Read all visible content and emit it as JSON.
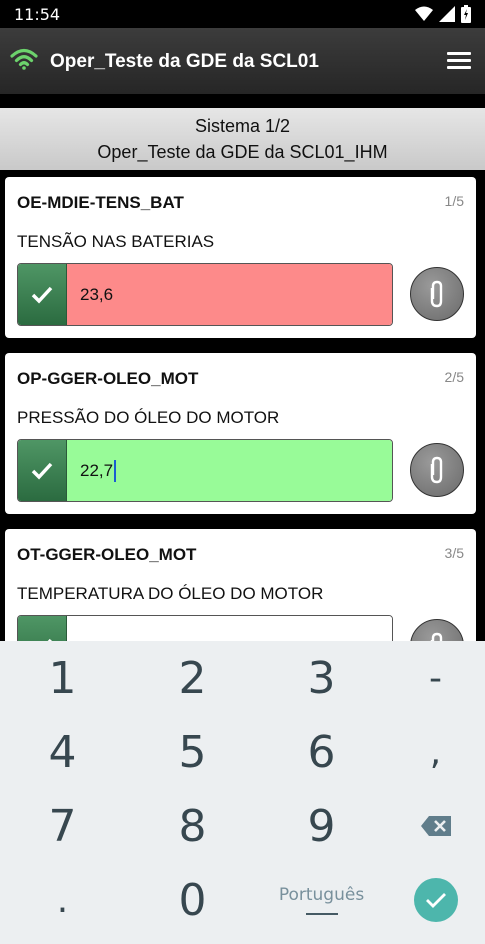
{
  "status_bar": {
    "time": "11:54"
  },
  "app_bar": {
    "title": "Oper_Teste da GDE da SCL01"
  },
  "header": {
    "line1": "Sistema 1/2",
    "line2": "Oper_Teste da GDE da SCL01_IHM"
  },
  "cards": [
    {
      "code": "OE-MDIE-TENS_BAT",
      "count": "1/5",
      "description": "TENSÃO NAS BATERIAS",
      "value": "23,6",
      "state_color": "#fd8a8a"
    },
    {
      "code": "OP-GGER-OLEO_MOT",
      "count": "2/5",
      "description": "PRESSÃO DO ÓLEO DO MOTOR",
      "value": "22,7",
      "state_color": "#98fb98"
    },
    {
      "code": "OT-GGER-OLEO_MOT",
      "count": "3/5",
      "description": "TEMPERATURA DO ÓLEO DO MOTOR",
      "value": "",
      "state_color": "#ffffff"
    }
  ],
  "keyboard": {
    "keys": [
      "1",
      "2",
      "3",
      "-",
      "4",
      "5",
      "6",
      ",",
      "7",
      "8",
      "9",
      "0",
      "."
    ],
    "language": "Português",
    "backspace_icon": "backspace-icon",
    "enter_icon": "check-icon",
    "enter_color": "#4db6ac"
  },
  "colors": {
    "accent_green": "#3b7f4f",
    "wifi_logo": "#6cd36c"
  }
}
